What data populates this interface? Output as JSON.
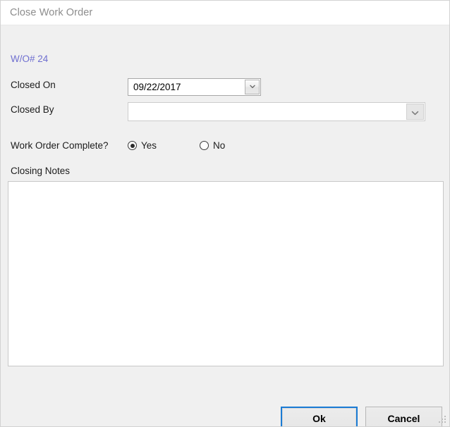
{
  "window": {
    "title": "Close Work Order",
    "accent_color": "#1a7bd4",
    "body_color": "#f0f0f0",
    "titlebar_color": "#ffffff"
  },
  "form": {
    "work_order_label": "W/O# 24",
    "work_order_label_color": "#6f6fd0",
    "closed_on": {
      "label": "Closed On",
      "value": "09/22/2017",
      "placeholder": ""
    },
    "closed_by": {
      "label": "Closed By",
      "value": "",
      "placeholder": ""
    },
    "work_order_complete": {
      "label": "Work Order Complete?",
      "selected": "Yes",
      "options": [
        {
          "label": "Yes",
          "checked": true
        },
        {
          "label": "No",
          "checked": false
        }
      ]
    },
    "closing_notes": {
      "label": "Closing Notes",
      "value": "",
      "placeholder": ""
    }
  },
  "footer": {
    "ok_label": "Ok",
    "cancel_label": "Cancel"
  }
}
